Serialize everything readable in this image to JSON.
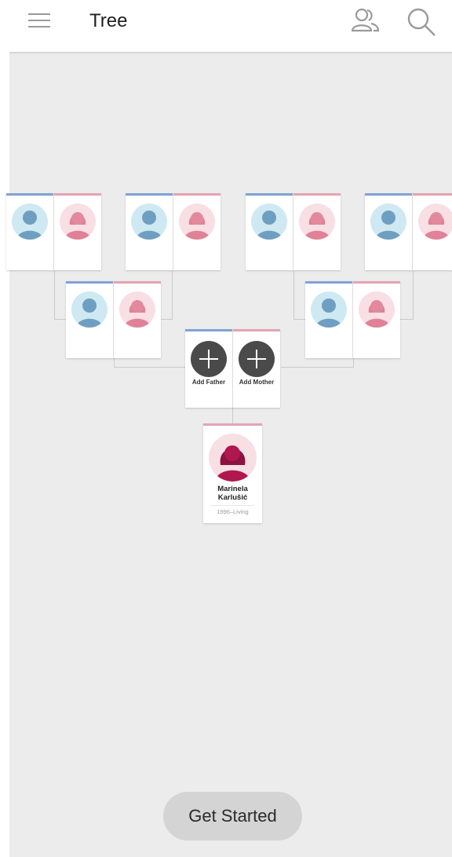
{
  "header": {
    "title": "Tree",
    "icons": {
      "menu": "hamburger-menu-icon",
      "people": "people-icon",
      "search": "search-icon"
    }
  },
  "tree": {
    "root": {
      "first_name": "Marinela",
      "last_name": "Karlušić",
      "dates": "1996–Living"
    },
    "parents": {
      "add_father": "Add Father",
      "add_mother": "Add Mother"
    }
  },
  "actions": {
    "get_started": "Get Started"
  },
  "colors": {
    "male_accent": "#7fa3d3",
    "female_accent": "#e3a4b1",
    "male_avatar_bg": "#cfe9f3",
    "female_avatar_bg": "#f8dfe4",
    "canvas_bg": "#ececec"
  }
}
